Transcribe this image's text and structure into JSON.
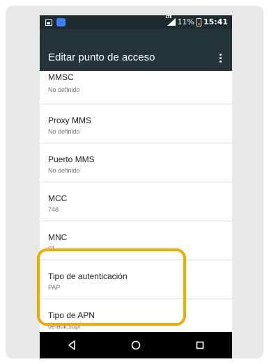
{
  "status_bar": {
    "network": "LTE",
    "battery": "11%",
    "time": "15:41"
  },
  "toolbar": {
    "title": "Editar punto de acceso",
    "menu_icon": "overflow-menu-icon"
  },
  "settings": [
    {
      "title": "MMSC",
      "summary": "No definido"
    },
    {
      "title": "Proxy MMS",
      "summary": "No definido"
    },
    {
      "title": "Puerto MMS",
      "summary": "No definido"
    },
    {
      "title": "MCC",
      "summary": "748"
    },
    {
      "title": "MNC",
      "summary": "01"
    },
    {
      "title": "Tipo de autenticación",
      "summary": "PAP"
    },
    {
      "title": "Tipo de APN",
      "summary": "default,supl"
    }
  ],
  "colors": {
    "toolbar": "#243438",
    "status_bar": "#1e2b2e",
    "highlight": "#f2a900"
  },
  "nav_icons": [
    "back-icon",
    "home-icon",
    "recents-icon"
  ]
}
